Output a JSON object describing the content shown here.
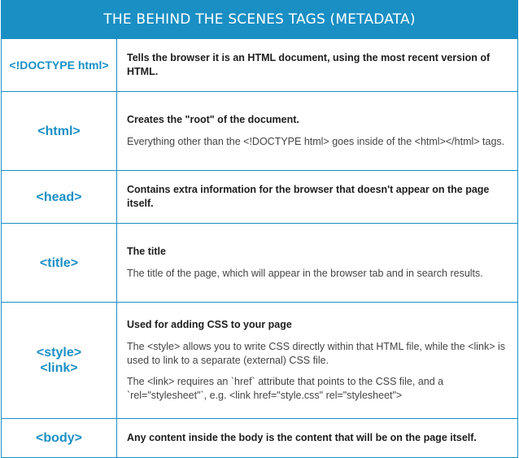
{
  "title": "THE BEHIND THE SCENES TAGS (METADATA)",
  "rows": [
    {
      "tag": "<!DOCTYPE html>",
      "heading": "Tells the browser it is an HTML document, using the most recent version of HTML.",
      "paragraphs": []
    },
    {
      "tag": "<html>",
      "heading": "Creates the \"root\" of the document.",
      "paragraphs": [
        "Everything other than the <!DOCTYPE html> goes inside of the <html></html> tags."
      ]
    },
    {
      "tag": "<head>",
      "heading": "Contains extra information for the browser that doesn't appear on the page itself.",
      "paragraphs": []
    },
    {
      "tag": "<title>",
      "heading": "The title",
      "paragraphs": [
        "The title of the page, which will appear in the browser tab and in search results."
      ]
    },
    {
      "tag": "<style>",
      "tag2": "<link>",
      "heading": "Used for adding CSS to your page",
      "paragraphs": [
        "The <style> allows you to write CSS directly within that HTML file, while the <link> is used to link to a separate (external) CSS file.",
        "The <link> requires an `href` attribute that points to the CSS file, and a `rel=\"stylesheet\"`,  e.g. <link href=\"style.css\" rel=\"stylesheet\">"
      ]
    },
    {
      "tag": "<body>",
      "heading": "Any content inside the body is the content that will be on the page itself.",
      "paragraphs": []
    }
  ]
}
